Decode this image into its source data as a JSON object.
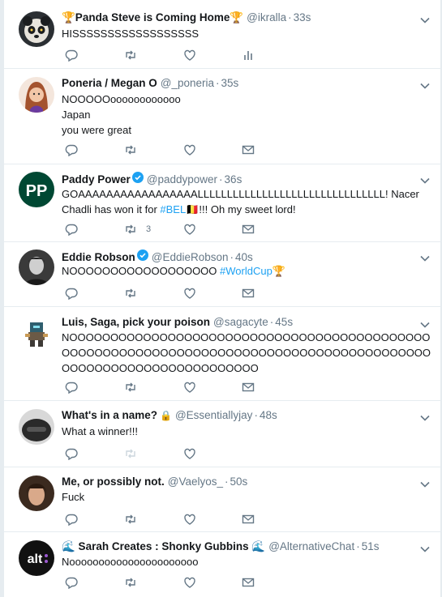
{
  "colors": {
    "accent": "#1da1f2",
    "text": "#14171a",
    "muted": "#657786",
    "divider": "#e6ecf0"
  },
  "tweets": [
    {
      "name": "🏆Panda Steve is Coming Home🏆",
      "handle": "@ikralla",
      "time": "33s",
      "text": [
        "HISSSSSSSSSSSSSSSSSS"
      ],
      "verified": false,
      "mail": false,
      "analytics": true,
      "avatar_icon": "panda-avatar"
    },
    {
      "name": "Poneria / Megan O",
      "handle": "@_poneria",
      "time": "35s",
      "text": [
        "NOOOOOoooooooooooo",
        "Japan",
        "you were great"
      ],
      "verified": false,
      "mail": true,
      "analytics": false,
      "avatar_icon": "illustrated-person-avatar"
    },
    {
      "name": "Paddy Power",
      "handle": "@paddypower",
      "time": "36s",
      "text_parts": [
        "GOAAAAAAAAAAAAAAAAALLLLLLLLLLLLLLLLLLLLLLLLLLLLLLLL! Nacer Chadli has won it for ",
        "#BEL",
        "🇧🇪!!! Oh my sweet lord!"
      ],
      "verified": true,
      "retweet_count": "3",
      "mail": true,
      "analytics": false,
      "avatar_icon": "pp-logo-avatar"
    },
    {
      "name": "Eddie Robson",
      "handle": "@EddieRobson",
      "time": "40s",
      "text_parts": [
        "NOOOOOOOOOOOOOOOOOO ",
        "#WorldCup",
        "🏆"
      ],
      "verified": true,
      "mail": true,
      "analytics": false,
      "avatar_icon": "bw-photo-avatar"
    },
    {
      "name": "Luis, Saga, pick your poison",
      "handle": "@sagacyte",
      "time": "45s",
      "text": [
        "NOOOOOOOOOOOOOOOOOOOOOOOOOOOOOOOOOOOOOOOOOOOOOOOOOOOOOOOOOOOOOOOOOOOOOOOOOOOOOOOOOOOOOOOOOOOOOOOOOOOOOOOOOOOOOOOOO"
      ],
      "verified": false,
      "mail": true,
      "analytics": false,
      "avatar_icon": "pixel-character-avatar"
    },
    {
      "name": "What's in a name?",
      "name_icon": "🔒",
      "handle": "@Essentiallyjay",
      "time": "48s",
      "text": [
        "What a winner!!!"
      ],
      "verified": false,
      "mail": false,
      "analytics": false,
      "avatar_icon": "dark-helmet-avatar"
    },
    {
      "name": "Me, or possibly not.",
      "handle": "@Vaelyos_",
      "time": "50s",
      "text": [
        "Fuck"
      ],
      "verified": false,
      "mail": true,
      "analytics": false,
      "avatar_icon": "face-photo-avatar"
    },
    {
      "name": "🌊 Sarah Creates : Shonky Gubbins 🌊",
      "handle": "@AlternativeChat",
      "time": "51s",
      "text": [
        "Noooooooooooooooooooooo"
      ],
      "verified": false,
      "mail": true,
      "analytics": false,
      "avatar_icon": "alt-logo-avatar"
    }
  ]
}
